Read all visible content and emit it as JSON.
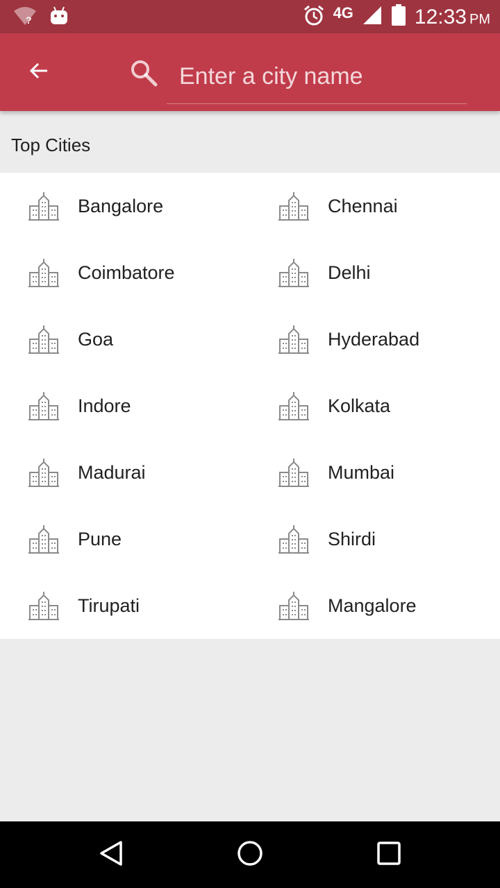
{
  "status_bar": {
    "network": "4G",
    "time": "12:33",
    "ampm": "PM",
    "icons": [
      "wifi-unknown-icon",
      "android-debug-icon",
      "alarm-icon",
      "signal-icon",
      "battery-icon"
    ]
  },
  "app_bar": {
    "back_icon": "arrow-back-icon",
    "search_icon": "search-icon",
    "search_placeholder": "Enter a city name",
    "search_value": ""
  },
  "section": {
    "title": "Top Cities"
  },
  "cities": [
    {
      "label": "Bangalore"
    },
    {
      "label": "Chennai"
    },
    {
      "label": "Coimbatore"
    },
    {
      "label": "Delhi"
    },
    {
      "label": "Goa"
    },
    {
      "label": "Hyderabad"
    },
    {
      "label": "Indore"
    },
    {
      "label": "Kolkata"
    },
    {
      "label": "Madurai"
    },
    {
      "label": "Mumbai"
    },
    {
      "label": "Pune"
    },
    {
      "label": "Shirdi"
    },
    {
      "label": "Tirupati"
    },
    {
      "label": "Mangalore"
    }
  ],
  "city_icon": "city-buildings-icon",
  "nav_bar": {
    "icons": [
      "back-triangle-icon",
      "home-circle-icon",
      "recents-square-icon"
    ]
  },
  "colors": {
    "status_bar": "#9e3440",
    "app_bar": "#c13c4b",
    "caret": "#7fd0d6",
    "background": "#ececec",
    "list_background": "#ffffff"
  }
}
